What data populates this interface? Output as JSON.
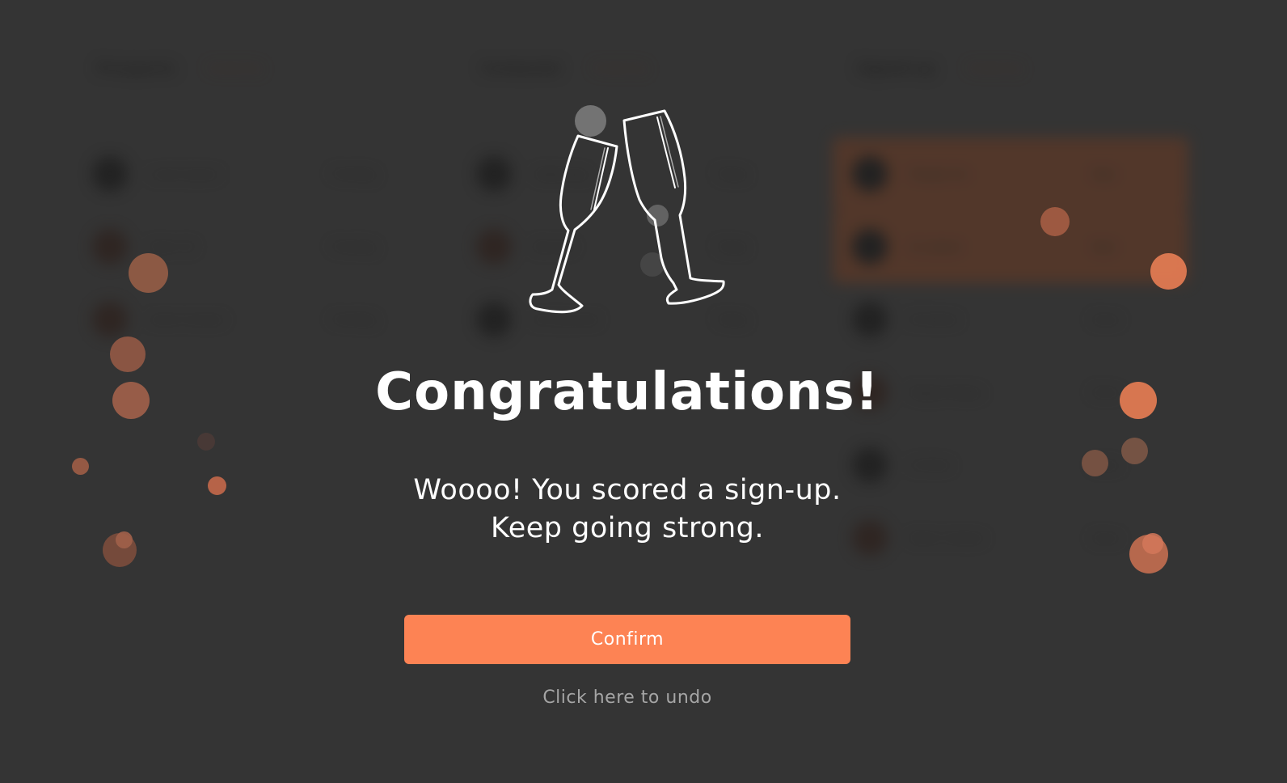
{
  "background_app": {
    "columns": [
      {
        "title": "Prospects",
        "subtitle": "Sorted by",
        "rows": [
          {
            "name": "Lorem Ipsum",
            "value": "Pending"
          },
          {
            "name": "Dolor Sit",
            "value": "Pending"
          },
          {
            "name": "Amet Consect",
            "value": "Pending"
          }
        ]
      },
      {
        "title": "Contacted",
        "subtitle": "Sorted by",
        "rows": [
          {
            "name": "Adipiscing",
            "value": "Today"
          },
          {
            "name": "Elit Sed",
            "value": "Today"
          },
          {
            "name": "Do Eiusmod",
            "value": "Today"
          }
        ]
      },
      {
        "title": "Signed up",
        "subtitle": "Sorted by",
        "rows": [
          {
            "name": "Tempor Inc",
            "value": "New"
          },
          {
            "name": "Ut Labore",
            "value": "New"
          },
          {
            "name": "Et Dolore",
            "value": "Done"
          },
          {
            "name": "Magna Aliqua",
            "value": "Done"
          },
          {
            "name": "Ut Enim",
            "value": "Done"
          },
          {
            "name": "Minim Veniam",
            "value": "Done"
          }
        ]
      }
    ]
  },
  "modal": {
    "icon": "champagne-glasses-icon",
    "title": "Congratulations!",
    "message_line1": "Woooo! You scored a sign-up.",
    "message_line2": "Keep going strong.",
    "confirm_label": "Confirm",
    "undo_label": "Click here to undo"
  },
  "colors": {
    "background": "#343434",
    "accent": "#fd8354",
    "text_primary": "#ffffff",
    "text_muted": "#a5a5a5"
  }
}
